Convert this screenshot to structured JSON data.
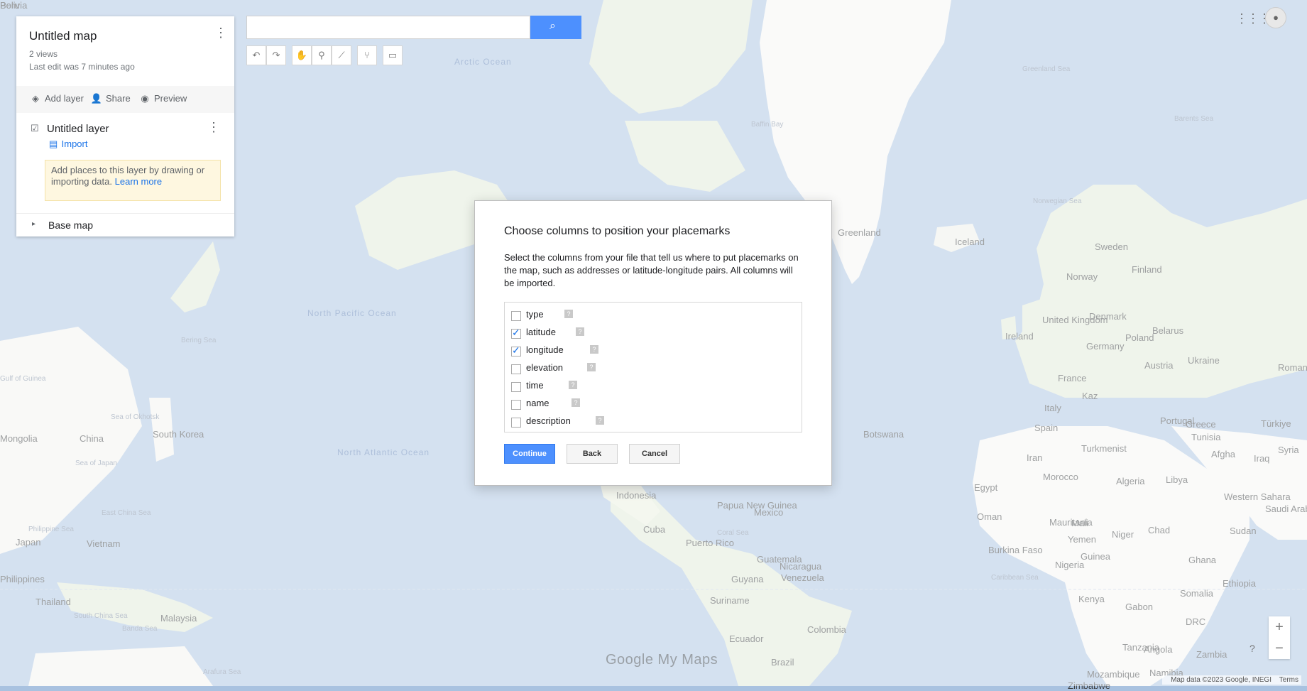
{
  "map": {
    "labels": [
      {
        "text": "Arctic Ocean",
        "kind": "water"
      },
      {
        "text": "Greenland Sea",
        "kind": "water-small"
      },
      {
        "text": "Baffin Bay",
        "kind": "water-small"
      },
      {
        "text": "Barents Sea",
        "kind": "water-small"
      },
      {
        "text": "Norwegian Sea",
        "kind": "water-small"
      },
      {
        "text": "Greenland",
        "kind": "land"
      },
      {
        "text": "Iceland",
        "kind": "land"
      },
      {
        "text": "Sweden",
        "kind": "land"
      },
      {
        "text": "Finland",
        "kind": "land"
      },
      {
        "text": "Norway",
        "kind": "land"
      },
      {
        "text": "United Kingdom",
        "kind": "land"
      },
      {
        "text": "Denmark",
        "kind": "land"
      },
      {
        "text": "Ireland",
        "kind": "land"
      },
      {
        "text": "Poland",
        "kind": "land"
      },
      {
        "text": "Belarus",
        "kind": "land"
      },
      {
        "text": "Germany",
        "kind": "land"
      },
      {
        "text": "Ukraine",
        "kind": "land"
      },
      {
        "text": "France",
        "kind": "land"
      },
      {
        "text": "Austria",
        "kind": "land"
      },
      {
        "text": "Romania",
        "kind": "land"
      },
      {
        "text": "Kaz",
        "kind": "land"
      },
      {
        "text": "Italy",
        "kind": "land"
      },
      {
        "text": "Spain",
        "kind": "land"
      },
      {
        "text": "Portugal",
        "kind": "land"
      },
      {
        "text": "Greece",
        "kind": "land"
      },
      {
        "text": "Türkiye",
        "kind": "land"
      },
      {
        "text": "Turkmenist",
        "kind": "land"
      },
      {
        "text": "Tunisia",
        "kind": "land"
      },
      {
        "text": "Syria",
        "kind": "land"
      },
      {
        "text": "Afgha",
        "kind": "land"
      },
      {
        "text": "Iraq",
        "kind": "land"
      },
      {
        "text": "Iran",
        "kind": "land"
      },
      {
        "text": "Morocco",
        "kind": "land"
      },
      {
        "text": "Algeria",
        "kind": "land"
      },
      {
        "text": "Libya",
        "kind": "land"
      },
      {
        "text": "Egypt",
        "kind": "land"
      },
      {
        "text": "Western Sahara",
        "kind": "land"
      },
      {
        "text": "Saudi Arabia",
        "kind": "land"
      },
      {
        "text": "Oman",
        "kind": "land"
      },
      {
        "text": "Mauritania",
        "kind": "land"
      },
      {
        "text": "Mali",
        "kind": "land"
      },
      {
        "text": "Niger",
        "kind": "land"
      },
      {
        "text": "Chad",
        "kind": "land"
      },
      {
        "text": "Sudan",
        "kind": "land"
      },
      {
        "text": "Yemen",
        "kind": "land"
      },
      {
        "text": "Burkina Faso",
        "kind": "land"
      },
      {
        "text": "Guinea",
        "kind": "land"
      },
      {
        "text": "Nigeria",
        "kind": "land"
      },
      {
        "text": "Ghana",
        "kind": "land"
      },
      {
        "text": "Ethiopia",
        "kind": "land"
      },
      {
        "text": "Somalia",
        "kind": "land"
      },
      {
        "text": "Kenya",
        "kind": "land"
      },
      {
        "text": "Gabon",
        "kind": "land"
      },
      {
        "text": "DRC",
        "kind": "land"
      },
      {
        "text": "Tanzania",
        "kind": "land"
      },
      {
        "text": "Angola",
        "kind": "land"
      },
      {
        "text": "Zambia",
        "kind": "land"
      },
      {
        "text": "Mozambique",
        "kind": "land"
      },
      {
        "text": "Namibia",
        "kind": "land"
      },
      {
        "text": "Zimbabwe",
        "kind": "land"
      },
      {
        "text": "Botswana",
        "kind": "land"
      },
      {
        "text": "North Atlantic Ocean",
        "kind": "water"
      },
      {
        "text": "North Pacific Ocean",
        "kind": "water"
      },
      {
        "text": "Bering Sea",
        "kind": "water-small"
      },
      {
        "text": "Sea of Okhotsk",
        "kind": "water-small"
      },
      {
        "text": "Sea of Japan",
        "kind": "water-small"
      },
      {
        "text": "East China Sea",
        "kind": "water-small"
      },
      {
        "text": "Philippine Sea",
        "kind": "water-small"
      },
      {
        "text": "South China Sea",
        "kind": "water-small"
      },
      {
        "text": "Banda Sea",
        "kind": "water-small"
      },
      {
        "text": "Arafura Sea",
        "kind": "water-small"
      },
      {
        "text": "Coral Sea",
        "kind": "water-small"
      },
      {
        "text": "Caribbean Sea",
        "kind": "water-small"
      },
      {
        "text": "Gulf of Guinea",
        "kind": "water-small"
      },
      {
        "text": "Mongolia",
        "kind": "land"
      },
      {
        "text": "China",
        "kind": "land"
      },
      {
        "text": "South Korea",
        "kind": "land"
      },
      {
        "text": "Japan",
        "kind": "land"
      },
      {
        "text": "Vietnam",
        "kind": "land"
      },
      {
        "text": "Philippines",
        "kind": "land"
      },
      {
        "text": "Thailand",
        "kind": "land"
      },
      {
        "text": "Malaysia",
        "kind": "land"
      },
      {
        "text": "Indonesia",
        "kind": "land"
      },
      {
        "text": "Papua New Guinea",
        "kind": "land"
      },
      {
        "text": "Mexico",
        "kind": "land"
      },
      {
        "text": "Cuba",
        "kind": "land"
      },
      {
        "text": "Puerto Rico",
        "kind": "land"
      },
      {
        "text": "Guatemala",
        "kind": "land"
      },
      {
        "text": "Nicaragua",
        "kind": "land"
      },
      {
        "text": "Venezuela",
        "kind": "land"
      },
      {
        "text": "Guyana",
        "kind": "land"
      },
      {
        "text": "Suriname",
        "kind": "land"
      },
      {
        "text": "Colombia",
        "kind": "land"
      },
      {
        "text": "Ecuador",
        "kind": "land"
      },
      {
        "text": "Brazil",
        "kind": "land"
      },
      {
        "text": "Peru",
        "kind": "land"
      },
      {
        "text": "Bolivia",
        "kind": "land"
      }
    ]
  },
  "panel": {
    "title": "Untitled map",
    "views": "2 views",
    "last_edit": "Last edit was 7 minutes ago",
    "actions": {
      "add_layer": "Add layer",
      "share": "Share",
      "preview": "Preview"
    },
    "layer": {
      "name": "Untitled layer",
      "import_label": "Import",
      "hint_text": "Add places to this layer by drawing or importing data.",
      "learn_more": "Learn more"
    },
    "base_map": "Base map"
  },
  "search": {
    "value": "",
    "placeholder": ""
  },
  "toolbar": {
    "icons": [
      "undo-icon",
      "redo-icon",
      "hand-icon",
      "marker-icon",
      "draw-line-icon",
      "directions-icon",
      "ruler-icon"
    ]
  },
  "branding": {
    "logo_text": "Google My Maps"
  },
  "attribution": {
    "map_data": "Map data ©2023 Google, INEGI",
    "terms": "Terms"
  },
  "zoom": {
    "in": "+",
    "out": "−"
  },
  "help": "?",
  "dialog": {
    "title": "Choose columns to position your placemarks",
    "description": "Select the columns from your file that tell us where to put placemarks on the map, such as addresses or latitude-longitude pairs. All columns will be imported.",
    "columns": [
      {
        "label": "type",
        "checked": false
      },
      {
        "label": "latitude",
        "checked": true
      },
      {
        "label": "longitude",
        "checked": true
      },
      {
        "label": "elevation",
        "checked": false
      },
      {
        "label": "time",
        "checked": false
      },
      {
        "label": "name",
        "checked": false
      },
      {
        "label": "description",
        "checked": false
      }
    ],
    "help_glyph": "?",
    "buttons": {
      "continue": "Continue",
      "back": "Back",
      "cancel": "Cancel"
    }
  },
  "colors": {
    "water": "#a9c2e0",
    "land": "#f5f5f3",
    "primary": "#4d90fe",
    "link": "#1a73e8"
  }
}
